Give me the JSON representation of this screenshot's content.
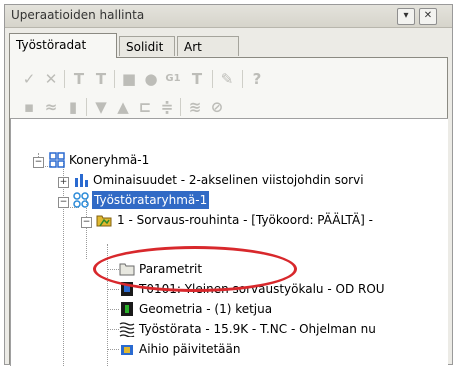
{
  "window": {
    "title": "Uperaatioiden hallinta",
    "pin_icon": "pin-icon",
    "close_icon": "close-icon"
  },
  "tabs": [
    {
      "label": "Työstöradat",
      "active": true
    },
    {
      "label": "Solidit",
      "active": false
    },
    {
      "label": "Art",
      "active": false
    }
  ],
  "toolbar_row1": [
    {
      "icon": "select-all-icon",
      "glyph": "✓✓"
    },
    {
      "icon": "deselect-icon",
      "glyph": "✓✕"
    },
    {
      "icon": "regenerate-icon",
      "glyph": "T"
    },
    {
      "icon": "regenerate-dirty-icon",
      "glyph": "T"
    },
    {
      "icon": "backplot-icon",
      "glyph": "■"
    },
    {
      "icon": "verify-icon",
      "glyph": "●"
    },
    {
      "icon": "post-icon",
      "glyph": "G1"
    },
    {
      "icon": "high-speed-icon",
      "glyph": "T"
    },
    {
      "icon": "delete-icon",
      "glyph": "✎"
    },
    {
      "icon": "help-icon",
      "glyph": "?"
    }
  ],
  "toolbar_row2": [
    {
      "icon": "lock-icon",
      "glyph": "▪"
    },
    {
      "icon": "wave-icon",
      "glyph": "≈"
    },
    {
      "icon": "page-icon",
      "glyph": "▮"
    },
    {
      "icon": "move-down-icon",
      "glyph": "▼"
    },
    {
      "icon": "move-up-icon",
      "glyph": "▲"
    },
    {
      "icon": "insert-icon",
      "glyph": "⊏"
    },
    {
      "icon": "lines-icon",
      "glyph": "≑"
    },
    {
      "icon": "toolpath-toggle-icon",
      "glyph": "≋"
    },
    {
      "icon": "filter-icon",
      "glyph": "⊘"
    }
  ],
  "tree": {
    "root": "Koneryhmä-1",
    "properties": "Ominaisuudet - 2-akselinen viistojohdin sorvi",
    "group": "Työstörataryhmä-1",
    "operation": "1 - Sorvaus-rouhinta - [Työkoord: PÄÄLTÄ] -",
    "children": [
      {
        "label": "Parametrit",
        "icon": "folder-icon"
      },
      {
        "label": "T0101: Yleinen sorvaustyökalu - OD ROU",
        "icon": "tool-icon"
      },
      {
        "label": "Geometria - (1) ketjua",
        "icon": "geometry-icon"
      },
      {
        "label": "Työstörata - 15.9K - T.NC - Ohjelman nu",
        "icon": "toolpath-icon"
      },
      {
        "label": "Aihio päivitetään",
        "icon": "stock-icon"
      }
    ]
  },
  "annotation": {
    "color": "#d8282c"
  }
}
